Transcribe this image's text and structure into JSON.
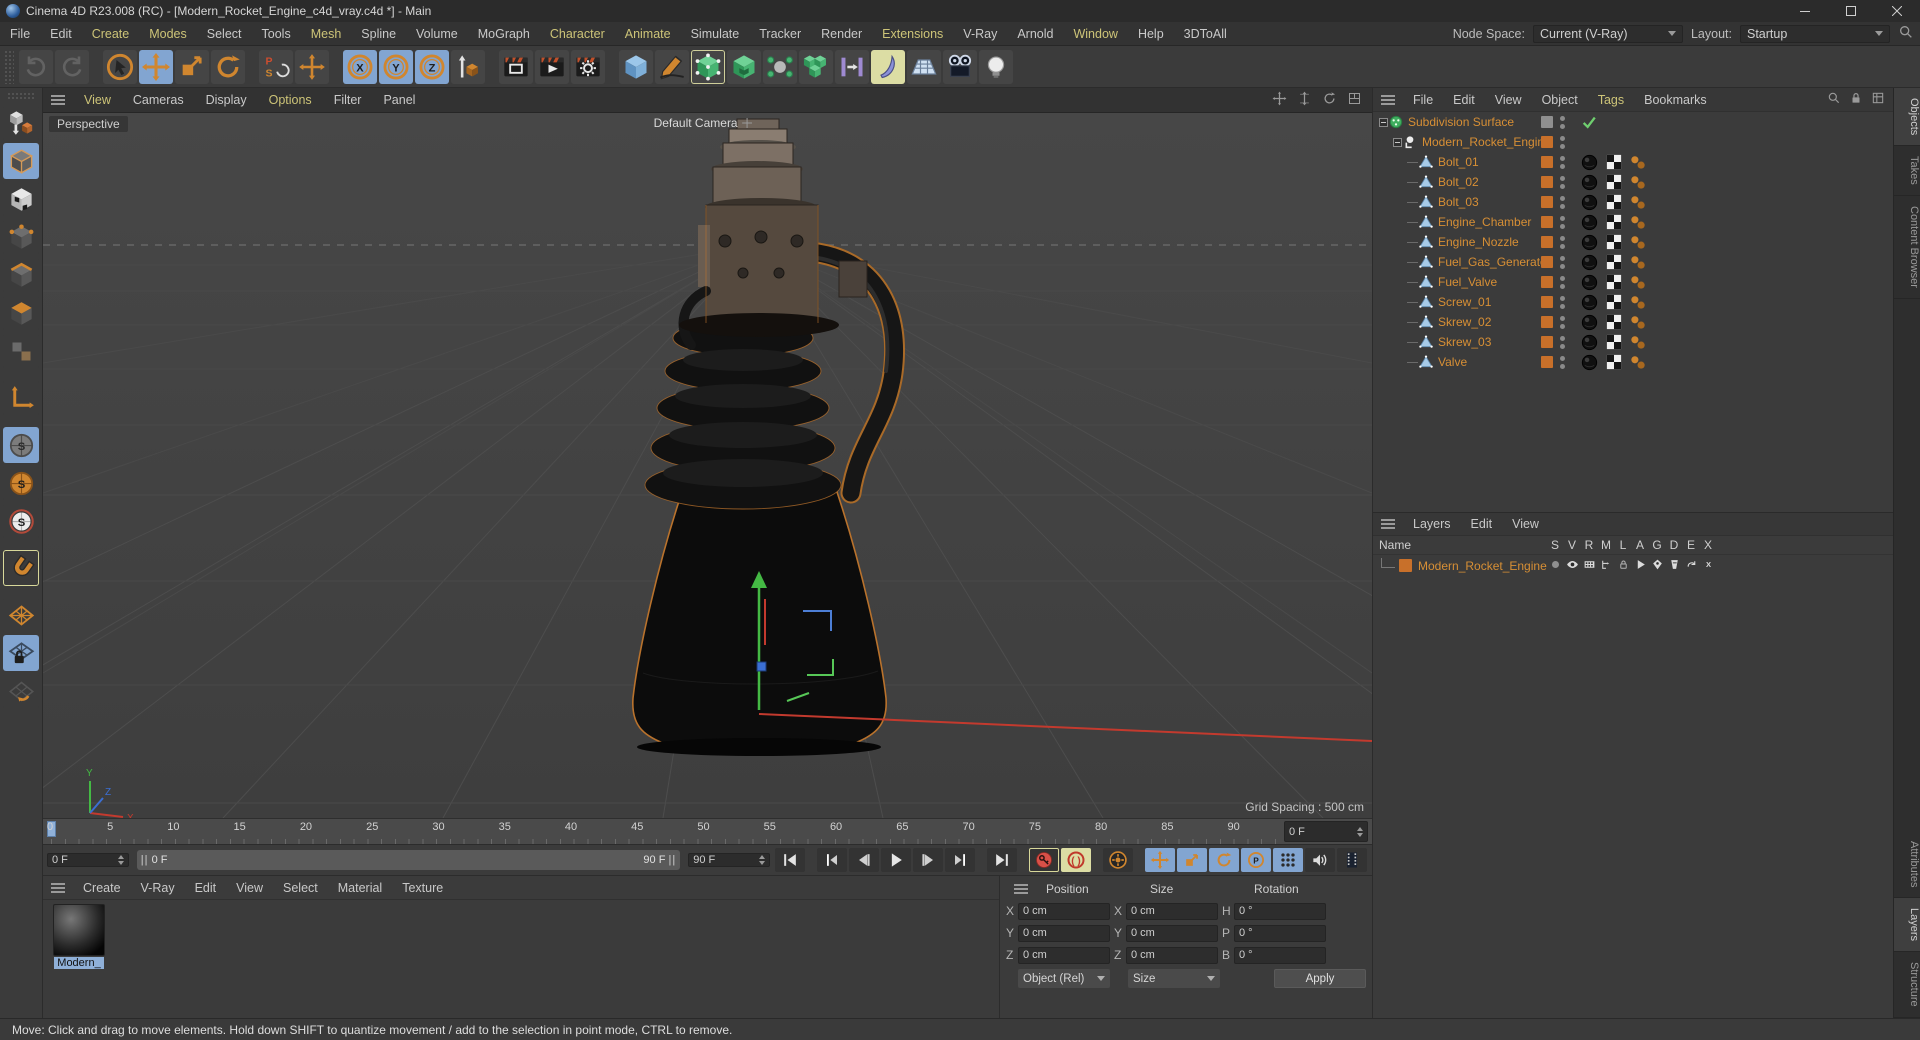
{
  "window": {
    "title": "Cinema 4D R23.008 (RC) - [Modern_Rocket_Engine_c4d_vray.c4d *] - Main"
  },
  "menubar": {
    "items": [
      {
        "label": "File"
      },
      {
        "label": "Edit"
      },
      {
        "label": "Create",
        "accent": true
      },
      {
        "label": "Modes",
        "accent": true
      },
      {
        "label": "Select"
      },
      {
        "label": "Tools"
      },
      {
        "label": "Mesh",
        "accent": true
      },
      {
        "label": "Spline"
      },
      {
        "label": "Volume"
      },
      {
        "label": "MoGraph"
      },
      {
        "label": "Character",
        "accent": true
      },
      {
        "label": "Animate",
        "accent": true
      },
      {
        "label": "Simulate"
      },
      {
        "label": "Tracker"
      },
      {
        "label": "Render"
      },
      {
        "label": "Extensions",
        "accent": true
      },
      {
        "label": "V-Ray"
      },
      {
        "label": "Arnold"
      },
      {
        "label": "Window",
        "accent": true
      },
      {
        "label": "Help"
      },
      {
        "label": "3DToAll"
      }
    ],
    "node_space_label": "Node Space:",
    "node_space_value": "Current (V-Ray)",
    "layout_label": "Layout:",
    "layout_value": "Startup"
  },
  "toolbar": {
    "items": [
      {
        "name": "undo-icon",
        "state": "disabled"
      },
      {
        "name": "redo-icon",
        "state": "disabled"
      },
      {
        "sep": true
      },
      {
        "name": "live-selection-icon"
      },
      {
        "name": "move-icon",
        "state": "active"
      },
      {
        "name": "scale-icon"
      },
      {
        "name": "rotate-icon"
      },
      {
        "sep": true
      },
      {
        "name": "last-tool-icon"
      },
      {
        "name": "axis-move-icon"
      },
      {
        "sep": true
      },
      {
        "name": "lock-x-icon",
        "state": "active",
        "letter": "X"
      },
      {
        "name": "lock-y-icon",
        "state": "active",
        "letter": "Y"
      },
      {
        "name": "lock-z-icon",
        "state": "active",
        "letter": "Z"
      },
      {
        "name": "coordinate-system-icon"
      },
      {
        "sep": true
      },
      {
        "name": "render-view-icon"
      },
      {
        "name": "render-animation-icon"
      },
      {
        "name": "render-settings-icon"
      },
      {
        "sep": true
      },
      {
        "name": "primitive-cube-icon"
      },
      {
        "name": "spline-pen-icon"
      },
      {
        "name": "subdivision-surface-icon",
        "state": "ol"
      },
      {
        "name": "instance-icon"
      },
      {
        "name": "cluster-icon"
      },
      {
        "name": "array-icon"
      },
      {
        "name": "connector-icon"
      },
      {
        "name": "bend-deformer-icon",
        "state": "hl"
      },
      {
        "name": "environment-icon"
      },
      {
        "name": "camera-icon"
      },
      {
        "name": "light-icon"
      }
    ]
  },
  "palette": {
    "items": [
      {
        "name": "make-editable-icon"
      },
      {
        "name": "model-mode-icon",
        "state": "active"
      },
      {
        "name": "texture-mode-icon"
      },
      {
        "name": "point-mode-icon"
      },
      {
        "name": "edge-mode-icon"
      },
      {
        "name": "polygon-mode-icon"
      },
      {
        "name": "tweak-mode-icon",
        "state": "disabled"
      },
      {
        "name": "workplane-axis-icon",
        "gap": true
      },
      {
        "name": "snap-off-icon",
        "state": "active",
        "gap": true
      },
      {
        "name": "snap-2d-icon"
      },
      {
        "name": "snap-3d-icon"
      },
      {
        "name": "enable-snap-icon",
        "state": "hl",
        "gap": true
      },
      {
        "name": "workplane-icon",
        "gap": true
      },
      {
        "name": "lock-workplane-icon",
        "state": "active"
      },
      {
        "name": "rotate-workplane-icon"
      }
    ]
  },
  "viewport": {
    "menu": [
      {
        "label": "View",
        "accent": true
      },
      {
        "label": "Cameras"
      },
      {
        "label": "Display"
      },
      {
        "label": "Options",
        "accent": true
      },
      {
        "label": "Filter"
      },
      {
        "label": "Panel"
      }
    ],
    "corner_icons": [
      "pan-view-icon",
      "dolly-view-icon",
      "rotate-view-icon",
      "toggle-layout-icon"
    ],
    "view_label": "Perspective",
    "camera_label": "Default Camera",
    "grid_spacing": "Grid Spacing : 500 cm"
  },
  "timeline": {
    "ticks": [
      "0",
      "5",
      "10",
      "15",
      "20",
      "25",
      "30",
      "35",
      "40",
      "45",
      "50",
      "55",
      "60",
      "65",
      "70",
      "75",
      "80",
      "85",
      "90"
    ],
    "frame_field": "0 F",
    "range_start": "0 F",
    "range_end": "90 F",
    "end_field": "90 F"
  },
  "transport": {
    "buttons": [
      {
        "name": "goto-start-icon"
      },
      {
        "gap": true
      },
      {
        "name": "prev-key-icon"
      },
      {
        "name": "prev-frame-icon"
      },
      {
        "name": "play-icon"
      },
      {
        "name": "next-frame-icon"
      },
      {
        "name": "next-key-icon"
      },
      {
        "gap": true
      },
      {
        "name": "goto-end-icon"
      },
      {
        "gap": true
      },
      {
        "name": "record-keyframe-icon",
        "state": "ol"
      },
      {
        "name": "autokeying-icon",
        "state": "hl"
      },
      {
        "gap": true
      },
      {
        "name": "keying-settings-icon"
      },
      {
        "gap": true
      },
      {
        "name": "key-position-icon",
        "state": "active"
      },
      {
        "name": "key-scale-icon",
        "state": "active"
      },
      {
        "name": "key-rotation-icon",
        "state": "active"
      },
      {
        "name": "key-parameter-icon",
        "state": "active"
      },
      {
        "name": "key-pla-icon",
        "state": "active"
      },
      {
        "flex": true
      },
      {
        "name": "sound-icon"
      },
      {
        "name": "render-preview-icon"
      }
    ]
  },
  "material_manager": {
    "menu": [
      {
        "label": "Create"
      },
      {
        "label": "V-Ray"
      },
      {
        "label": "Edit"
      },
      {
        "label": "View"
      },
      {
        "label": "Select"
      },
      {
        "label": "Material"
      },
      {
        "label": "Texture"
      }
    ],
    "materials": [
      {
        "name": "Modern_"
      }
    ]
  },
  "coordinates": {
    "groups": [
      {
        "title": "Position",
        "rows": [
          {
            "label": "X",
            "value": "0 cm"
          },
          {
            "label": "Y",
            "value": "0 cm"
          },
          {
            "label": "Z",
            "value": "0 cm"
          }
        ]
      },
      {
        "title": "Size",
        "rows": [
          {
            "label": "X",
            "value": "0 cm"
          },
          {
            "label": "Y",
            "value": "0 cm"
          },
          {
            "label": "Z",
            "value": "0 cm"
          }
        ]
      },
      {
        "title": "Rotation",
        "rows": [
          {
            "label": "H",
            "value": "0 °"
          },
          {
            "label": "P",
            "value": "0 °"
          },
          {
            "label": "B",
            "value": "0 °"
          }
        ]
      }
    ],
    "mode_value": "Object (Rel)",
    "size_value": "Size",
    "apply_label": "Apply"
  },
  "object_manager": {
    "menu": [
      {
        "label": "File"
      },
      {
        "label": "Edit"
      },
      {
        "label": "View"
      },
      {
        "label": "Object"
      },
      {
        "label": "Tags",
        "accent": true
      },
      {
        "label": "Bookmarks"
      }
    ],
    "corner_icons": [
      "search-icon",
      "lock-icon",
      "panel-grid-icon"
    ],
    "objects": [
      {
        "name": "Subdivision Surface",
        "icon": "subdivision-object-icon",
        "level": 0,
        "expander": true,
        "layer_color": "#8f8f8f",
        "tags": [
          "check"
        ]
      },
      {
        "name": "Modern_Rocket_Engine",
        "icon": "null-object-icon",
        "level": 1,
        "expander": true,
        "layer_color": "#c8702a",
        "tags": []
      },
      {
        "name": "Bolt_01",
        "icon": "polygon-object-icon",
        "level": 2,
        "layer_color": "#c8702a",
        "tags": [
          "material",
          "uvw",
          "phong"
        ]
      },
      {
        "name": "Bolt_02",
        "icon": "polygon-object-icon",
        "level": 2,
        "layer_color": "#c8702a",
        "tags": [
          "material",
          "uvw",
          "phong"
        ]
      },
      {
        "name": "Bolt_03",
        "icon": "polygon-object-icon",
        "level": 2,
        "layer_color": "#c8702a",
        "tags": [
          "material",
          "uvw",
          "phong"
        ]
      },
      {
        "name": "Engine_Chamber",
        "icon": "polygon-object-icon",
        "level": 2,
        "layer_color": "#c8702a",
        "tags": [
          "material",
          "uvw",
          "phong"
        ]
      },
      {
        "name": "Engine_Nozzle",
        "icon": "polygon-object-icon",
        "level": 2,
        "layer_color": "#c8702a",
        "tags": [
          "material",
          "uvw",
          "phong"
        ]
      },
      {
        "name": "Fuel_Gas_Generator",
        "icon": "polygon-object-icon",
        "level": 2,
        "layer_color": "#c8702a",
        "tags": [
          "material",
          "uvw",
          "phong"
        ]
      },
      {
        "name": "Fuel_Valve",
        "icon": "polygon-object-icon",
        "level": 2,
        "layer_color": "#c8702a",
        "tags": [
          "material",
          "uvw",
          "phong"
        ]
      },
      {
        "name": "Screw_01",
        "icon": "polygon-object-icon",
        "level": 2,
        "layer_color": "#c8702a",
        "tags": [
          "material",
          "uvw",
          "phong"
        ]
      },
      {
        "name": "Skrew_02",
        "icon": "polygon-object-icon",
        "level": 2,
        "layer_color": "#c8702a",
        "tags": [
          "material",
          "uvw",
          "phong"
        ]
      },
      {
        "name": "Skrew_03",
        "icon": "polygon-object-icon",
        "level": 2,
        "layer_color": "#c8702a",
        "tags": [
          "material",
          "uvw",
          "phong"
        ]
      },
      {
        "name": "Valve",
        "icon": "polygon-object-icon",
        "level": 2,
        "layer_color": "#c8702a",
        "tags": [
          "material",
          "uvw",
          "phong"
        ]
      }
    ]
  },
  "layers_panel": {
    "menu": [
      {
        "label": "Layers"
      },
      {
        "label": "Edit"
      },
      {
        "label": "View"
      }
    ],
    "name_header": "Name",
    "columns": [
      "S",
      "V",
      "R",
      "M",
      "L",
      "A",
      "G",
      "D",
      "E",
      "X"
    ],
    "rows": [
      {
        "name": "Modern_Rocket_Engine",
        "color": "#c8702a"
      }
    ]
  },
  "right_tabs": {
    "top": [
      {
        "label": "Objects",
        "active": true
      },
      {
        "label": "Takes"
      },
      {
        "label": "Content Browser"
      }
    ],
    "bottom": [
      {
        "label": "Attributes"
      },
      {
        "label": "Layers",
        "active": true
      },
      {
        "label": "Structure"
      }
    ]
  },
  "status": {
    "text": "Move: Click and drag to move elements. Hold down SHIFT to quantize movement / add to the selection in point mode, CTRL to remove."
  },
  "colors": {
    "accent_orange": "#d0862f",
    "selection_blue": "#82a5d1",
    "highlight_yellow": "#dcdda4",
    "label_orange": "#d78f35",
    "axis_red": "#c33a2e",
    "axis_green": "#44b944",
    "axis_blue": "#3b6fd4"
  }
}
